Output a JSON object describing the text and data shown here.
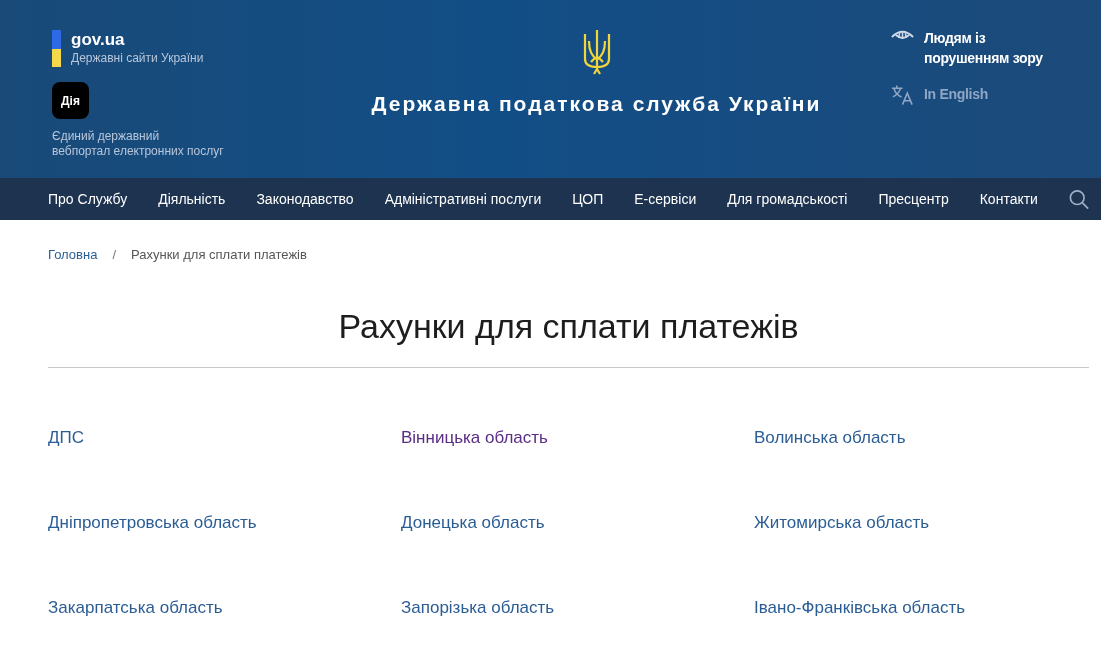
{
  "header": {
    "govua": {
      "logo": "gov.ua",
      "subtitle": "Державні сайти України"
    },
    "diia": {
      "logo": "Дія",
      "caption_lines": [
        "Єдиний державний",
        "вебпортал електронних послуг"
      ]
    },
    "site_title": "Державна податкова служба України",
    "accessibility_link": {
      "lines": [
        "Людям із",
        "порушенням зору"
      ]
    },
    "language_link": "In English"
  },
  "nav": {
    "items": [
      "Про Службу",
      "Діяльність",
      "Законодавство",
      "Адміністративні послуги",
      "ЦОП",
      "Е-сервіси",
      "Для громадськості",
      "Пресцентр",
      "Контакти"
    ]
  },
  "breadcrumbs": [
    {
      "label": "Головна",
      "link": true
    },
    {
      "label": "Рахунки для сплати платежів",
      "link": false
    }
  ],
  "breadcrumb_separator": "/",
  "page_title": "Рахунки для сплати платежів",
  "links": [
    {
      "label": "ДПС",
      "visited": false
    },
    {
      "label": "Вінницька область",
      "visited": true
    },
    {
      "label": "Волинська область",
      "visited": false
    },
    {
      "label": "Дніпропетровська область",
      "visited": false
    },
    {
      "label": "Донецька область",
      "visited": false
    },
    {
      "label": "Житомирська область",
      "visited": false
    },
    {
      "label": "Закарпатська область",
      "visited": false
    },
    {
      "label": "Запорізька область",
      "visited": false
    },
    {
      "label": "Івано-Франківська область",
      "visited": false
    }
  ]
}
